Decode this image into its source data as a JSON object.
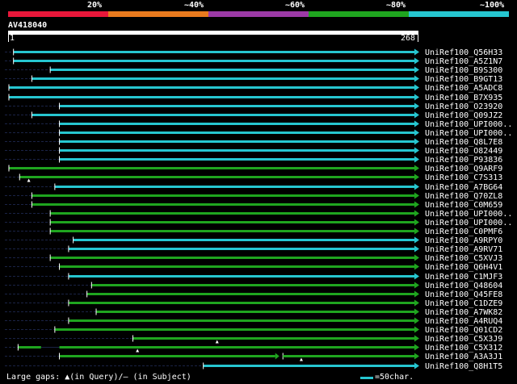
{
  "scale": {
    "labels": [
      "20%",
      "~40%",
      "~60%",
      "~80%",
      "~100%"
    ],
    "colors": [
      "#e8173a",
      "#e87a1e",
      "#9c3aa6",
      "#1fa51f",
      "#26c6d0"
    ]
  },
  "query": {
    "name": "AV418040",
    "start": "1",
    "end": "268",
    "length": 268
  },
  "colors": {
    "cyan": "#26c6d0",
    "green": "#1fa51f",
    "navy": "#1a2346",
    "label": "#ffffff"
  },
  "hits": [
    {
      "name": "UniRef100_Q56H33",
      "start": 4,
      "end": 268,
      "color": "cyan",
      "dash_from": 0
    },
    {
      "name": "UniRef100_A5Z1N7",
      "start": 4,
      "end": 268,
      "color": "cyan",
      "dash_from": 0
    },
    {
      "name": "UniRef100_B9S300",
      "start": 28,
      "end": 268,
      "color": "cyan",
      "dash_from": 0
    },
    {
      "name": "UniRef100_B9GT13",
      "start": 16,
      "end": 268,
      "color": "cyan",
      "dash_from": 0
    },
    {
      "name": "UniRef100_A5ADC8",
      "start": 1,
      "end": 268,
      "color": "cyan",
      "dash_from": 0
    },
    {
      "name": "UniRef100_B7X935",
      "start": 1,
      "end": 268,
      "color": "cyan",
      "dash_from": 0
    },
    {
      "name": "UniRef100_O23920",
      "start": 34,
      "end": 268,
      "color": "cyan",
      "dash_from": 0
    },
    {
      "name": "UniRef100_Q09JZ2",
      "start": 16,
      "end": 268,
      "color": "cyan",
      "dash_from": 0
    },
    {
      "name": "UniRef100_UPI000..",
      "start": 34,
      "end": 268,
      "color": "cyan",
      "dash_from": 0
    },
    {
      "name": "UniRef100_UPI000..",
      "start": 34,
      "end": 268,
      "color": "cyan",
      "dash_from": 0
    },
    {
      "name": "UniRef100_Q8L7E8",
      "start": 34,
      "end": 268,
      "color": "cyan",
      "dash_from": 0
    },
    {
      "name": "UniRef100_O82449",
      "start": 34,
      "end": 268,
      "color": "cyan",
      "dash_from": 0
    },
    {
      "name": "UniRef100_P93836",
      "start": 34,
      "end": 268,
      "color": "cyan",
      "dash_from": 0
    },
    {
      "name": "UniRef100_Q9ARF9",
      "start": 1,
      "end": 268,
      "color": "green",
      "dash_from": 0
    },
    {
      "name": "UniRef100_C7S313",
      "start": 8,
      "end": 268,
      "color": "green",
      "dash_from": 0,
      "gap_at": 14
    },
    {
      "name": "UniRef100_A7BG64",
      "start": 31,
      "end": 268,
      "color": "cyan",
      "dash_from": 0
    },
    {
      "name": "UniRef100_Q70ZL8",
      "start": 16,
      "end": 268,
      "color": "green",
      "dash_from": 0
    },
    {
      "name": "UniRef100_C0M659",
      "start": 16,
      "end": 268,
      "color": "green",
      "dash_from": 0
    },
    {
      "name": "UniRef100_UPI000..",
      "start": 28,
      "end": 268,
      "color": "green",
      "dash_from": 0
    },
    {
      "name": "UniRef100_UPI000..",
      "start": 28,
      "end": 268,
      "color": "green",
      "dash_from": 0
    },
    {
      "name": "UniRef100_C0PMF6",
      "start": 28,
      "end": 268,
      "color": "green",
      "dash_from": 0
    },
    {
      "name": "UniRef100_A9RPY0",
      "start": 43,
      "end": 268,
      "color": "cyan",
      "dash_from": 0
    },
    {
      "name": "UniRef100_A9RV71",
      "start": 40,
      "end": 268,
      "color": "cyan",
      "dash_from": 0
    },
    {
      "name": "UniRef100_C5XVJ3",
      "start": 28,
      "end": 268,
      "color": "green",
      "dash_from": 0
    },
    {
      "name": "UniRef100_Q6H4V1",
      "start": 34,
      "end": 268,
      "color": "green",
      "dash_from": 0
    },
    {
      "name": "UniRef100_C1MJF3",
      "start": 40,
      "end": 268,
      "color": "cyan",
      "dash_from": 0
    },
    {
      "name": "UniRef100_Q48604",
      "start": 55,
      "end": 268,
      "color": "green",
      "dash_from": 0
    },
    {
      "name": "UniRef100_Q45FE8",
      "start": 52,
      "end": 268,
      "color": "green",
      "dash_from": 0
    },
    {
      "name": "UniRef100_C1DZE9",
      "start": 40,
      "end": 268,
      "color": "green",
      "dash_from": 0
    },
    {
      "name": "UniRef100_A7WK82",
      "start": 58,
      "end": 268,
      "color": "green",
      "dash_from": 0
    },
    {
      "name": "UniRef100_A4RUQ4",
      "start": 40,
      "end": 268,
      "color": "green",
      "dash_from": 0
    },
    {
      "name": "UniRef100_Q01CD2",
      "start": 31,
      "end": 268,
      "color": "green",
      "dash_from": 0
    },
    {
      "name": "UniRef100_C5X3J9",
      "start": 82,
      "end": 268,
      "color": "green",
      "dash_from": 0,
      "gap_at": 137
    },
    {
      "name": "UniRef100_C5X312",
      "start": 7,
      "end": 268,
      "color": "green",
      "dash_from": 0,
      "gap_at": 85,
      "gap2": [
        22,
        34
      ]
    },
    {
      "name": "UniRef100_A3A3J1",
      "start": 34,
      "end": 268,
      "color": "green",
      "dash_from": 0,
      "gap_at": 192,
      "split": [
        175,
        180
      ]
    },
    {
      "name": "UniRef100_Q8H1T5",
      "start": 128,
      "end": 268,
      "color": "cyan",
      "dash_from": 0
    }
  ],
  "legend": {
    "gaps": "Large gaps: ▲(in Query)/— (in Subject)",
    "scale": "=50char."
  }
}
